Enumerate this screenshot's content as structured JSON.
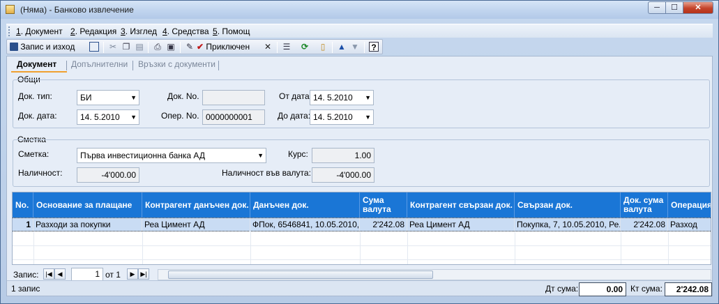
{
  "window": {
    "title": "(Няма) - Банково извлечение",
    "minimize": "─",
    "maximize": "☐",
    "close": "✕"
  },
  "menu": {
    "items": [
      {
        "key": "1",
        "label": ". Документ"
      },
      {
        "key": "2",
        "label": ". Редакция"
      },
      {
        "key": "3",
        "label": ". Изглед"
      },
      {
        "key": "4",
        "label": ". Средства"
      },
      {
        "key": "5",
        "label": ". Помощ"
      }
    ]
  },
  "toolbar": {
    "save_exit": "Запис и изход",
    "posted": "Приключен"
  },
  "tabs": [
    "Документ",
    "Допълнителни",
    "Връзки с документи"
  ],
  "general": {
    "title": "Общи",
    "doc_type_label": "Док. тип:",
    "doc_type": "БИ",
    "doc_no_label": "Док. No.",
    "doc_no": "",
    "from_date_label": "От дата:",
    "from_date": "14.  5.2010",
    "doc_date_label": "Док. дата:",
    "doc_date": "14.  5.2010",
    "oper_no_label": "Опер. No.",
    "oper_no": "0000000001",
    "to_date_label": "До дата:",
    "to_date": "14.  5.2010"
  },
  "account": {
    "title": "Сметка",
    "account_label": "Сметка:",
    "account": "Първа инвестиционна банка АД",
    "rate_label": "Курс:",
    "rate": "1.00",
    "balance_label": "Наличност:",
    "balance": "-4'000.00",
    "balance_currency_label": "Наличност във валута:",
    "balance_currency": "-4'000.00"
  },
  "grid": {
    "columns": [
      "No.",
      "Основание за плащане",
      "Контрагент данъчен док.",
      "Данъчен док.",
      "Сума валута",
      "Контрагент свързан док.",
      "Свързан док.",
      "Док. сума валута",
      "Операция"
    ],
    "rows": [
      [
        "1",
        "Разходи за покупки",
        "Реа Цимент АД",
        "ФПок, 6546841, 10.05.2010,...",
        "2'242.08",
        "Реа Цимент АД",
        "Покупка, 7, 10.05.2010, Ре...",
        "2'242.08",
        "Разход"
      ]
    ]
  },
  "navigator": {
    "label": "Запис:",
    "current": "1",
    "of": "от 1"
  },
  "status": {
    "records": "1 запис",
    "debit_label": "Дт сума:",
    "debit": "0.00",
    "credit_label": "Кт сума:",
    "credit": "2'242.08"
  },
  "colors": {
    "grid_header": "#1a76d6",
    "selected_row": "#c9dcf4",
    "tab_accent": "#f0a030"
  }
}
